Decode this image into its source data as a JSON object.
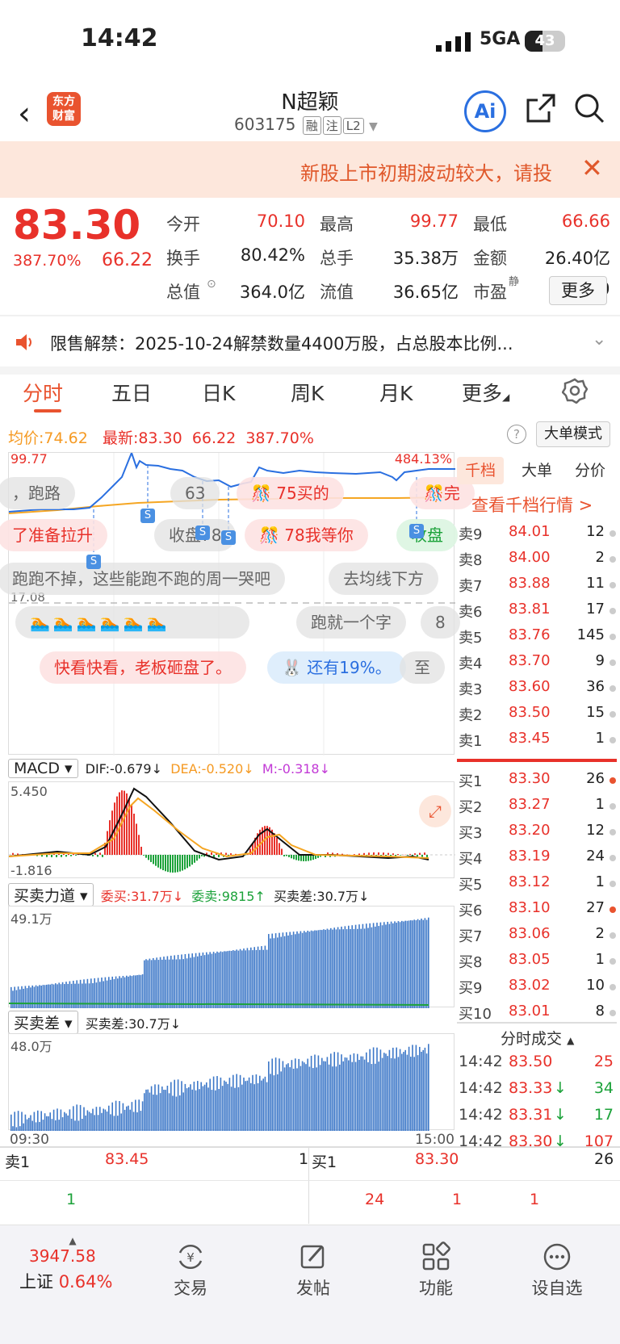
{
  "status": {
    "time": "14:42",
    "network": "5GA",
    "battery": "43",
    "battery_level": 0.43
  },
  "header": {
    "title": "N超颖",
    "code": "603175",
    "tags": [
      "融",
      "注",
      "L2"
    ],
    "ai_label": "Ai",
    "logo": [
      "东方",
      "财富"
    ]
  },
  "banner": {
    "text": "新股上市初期波动较大，请投",
    "close": "✕"
  },
  "quote": {
    "price": "83.30",
    "pct": "387.70%",
    "change": "66.22",
    "fields": [
      {
        "label": "今开",
        "value": "70.10",
        "color": "red"
      },
      {
        "label": "最高",
        "value": "99.77",
        "color": "red"
      },
      {
        "label": "最低",
        "value": "66.66",
        "color": "red"
      },
      {
        "label": "换手",
        "value": "80.42%",
        "color": "dark"
      },
      {
        "label": "总手",
        "value": "35.38万",
        "color": "dark"
      },
      {
        "label": "金额",
        "value": "26.40亿",
        "color": "dark"
      },
      {
        "label": "总值",
        "value": "364.0亿",
        "color": "dark"
      },
      {
        "label": "流值",
        "value": "36.65亿",
        "color": "dark"
      },
      {
        "label": "市盈",
        "value": "131.80",
        "color": "dark"
      }
    ],
    "pe_sup": "静",
    "more": "更多"
  },
  "notice": {
    "text": "限售解禁：2025-10-24解禁数量4400万股，占总股本比例..."
  },
  "tabs": [
    "分时",
    "五日",
    "日K",
    "周K",
    "月K",
    "更多"
  ],
  "legend": {
    "avg_label": "均价:",
    "avg": "74.62",
    "latest_label": "最新:",
    "latest": "83.30",
    "change": "66.22",
    "pct": "387.70%",
    "mode": "大单模式"
  },
  "chart": {
    "high": "99.77",
    "low_line": "17.08",
    "high_pct": "484.13%",
    "start_time": "09:30",
    "end_time": "15:00",
    "bubbles": [
      "，跑路",
      "63",
      "75买的",
      "完",
      "了准备拉升",
      "收盘78",
      "78我等你",
      "收盘",
      "跑跑不掉，这些能跑不跑的周一哭吧",
      "去均线下方",
      "跑就一个字",
      "8",
      "快看快看，老板砸盘了。",
      "还有19%。",
      "至"
    ]
  },
  "macd": {
    "selector": "MACD",
    "dif": "DIF:-0.679",
    "dea": "DEA:-0.520",
    "m": "M:-0.318",
    "top": "5.450",
    "bottom": "-1.816"
  },
  "force": {
    "selector": "买卖力道",
    "buy": "委买:31.7万",
    "sell": "委卖:9815",
    "diff": "买卖差:30.7万",
    "top": "49.1万"
  },
  "diffpanel": {
    "selector": "买卖差",
    "diff": "买卖差:30.7万",
    "top": "48.0万"
  },
  "orderbook": {
    "tabs": [
      "千档",
      "大单",
      "分价"
    ],
    "link": "查看千档行情 >",
    "asks": [
      {
        "label": "卖9",
        "price": "84.01",
        "vol": "12"
      },
      {
        "label": "卖8",
        "price": "84.00",
        "vol": "2"
      },
      {
        "label": "卖7",
        "price": "83.88",
        "vol": "11"
      },
      {
        "label": "卖6",
        "price": "83.81",
        "vol": "17"
      },
      {
        "label": "卖5",
        "price": "83.76",
        "vol": "145"
      },
      {
        "label": "卖4",
        "price": "83.70",
        "vol": "9"
      },
      {
        "label": "卖3",
        "price": "83.60",
        "vol": "36"
      },
      {
        "label": "卖2",
        "price": "83.50",
        "vol": "15"
      },
      {
        "label": "卖1",
        "price": "83.45",
        "vol": "1"
      }
    ],
    "bids": [
      {
        "label": "买1",
        "price": "83.30",
        "vol": "26",
        "dot": "o"
      },
      {
        "label": "买2",
        "price": "83.27",
        "vol": "1",
        "dot": ""
      },
      {
        "label": "买3",
        "price": "83.20",
        "vol": "12",
        "dot": ""
      },
      {
        "label": "买4",
        "price": "83.19",
        "vol": "24",
        "dot": ""
      },
      {
        "label": "买5",
        "price": "83.12",
        "vol": "1",
        "dot": ""
      },
      {
        "label": "买6",
        "price": "83.10",
        "vol": "27",
        "dot": "o"
      },
      {
        "label": "买7",
        "price": "83.06",
        "vol": "2",
        "dot": ""
      },
      {
        "label": "买8",
        "price": "83.05",
        "vol": "1",
        "dot": ""
      },
      {
        "label": "买9",
        "price": "83.02",
        "vol": "10",
        "dot": ""
      },
      {
        "label": "买10",
        "price": "83.01",
        "vol": "8",
        "dot": ""
      }
    ],
    "trades_header": "分时成交",
    "trades": [
      {
        "time": "14:42",
        "price": "83.50",
        "arrow": "",
        "vol": "25",
        "color": "red"
      },
      {
        "time": "14:42",
        "price": "83.33",
        "arrow": "↓",
        "vol": "34",
        "color": "green"
      },
      {
        "time": "14:42",
        "price": "83.31",
        "arrow": "↓",
        "vol": "17",
        "color": "green"
      },
      {
        "time": "14:42",
        "price": "83.30",
        "arrow": "↓",
        "vol": "107",
        "color": "red"
      }
    ]
  },
  "bottom_quote": {
    "ask_label": "卖1",
    "ask_price": "83.45",
    "ask_vol": "1",
    "ask_sub": "1",
    "bid_label": "买1",
    "bid_price": "83.30",
    "bid_vol": "26",
    "bid_subs": [
      "24",
      "1",
      "1"
    ]
  },
  "nav": {
    "index_value": "3947.58",
    "index_name": "上证",
    "index_pct": "0.64%",
    "items": [
      "交易",
      "发帖",
      "功能",
      "设自选"
    ]
  }
}
